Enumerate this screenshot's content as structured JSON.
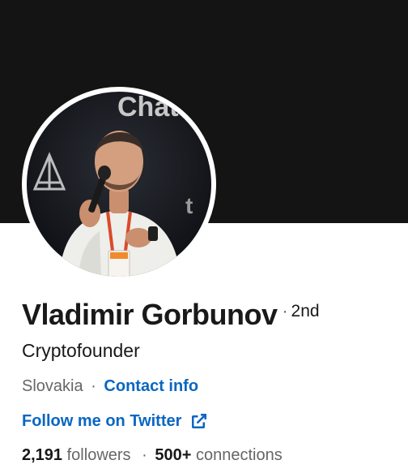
{
  "profile": {
    "name": "Vladimir Gorbunov",
    "degree": "2nd",
    "degree_separator": "·",
    "headline": "Cryptofounder",
    "location": "Slovakia",
    "location_separator": "·",
    "contact_info": "Contact info",
    "website_link": "Follow me on Twitter",
    "followers_count": "2,191",
    "followers_label": "followers",
    "stats_separator": "·",
    "connections_count": "500+",
    "connections_label": "connections"
  },
  "icons": {
    "external_link": "external-link-icon"
  },
  "colors": {
    "banner": "#141414",
    "link": "#0a66c2",
    "primary_text": "#191919",
    "secondary_text": "#666666"
  }
}
